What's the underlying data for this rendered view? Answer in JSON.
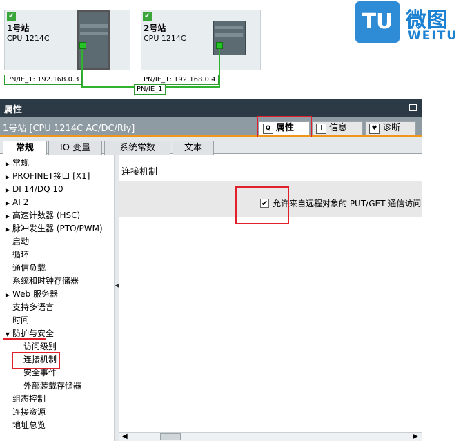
{
  "network": {
    "station1": {
      "name": "1号站",
      "cpu": "CPU 1214C",
      "address": "PN/IE_1: 192.168.0.3"
    },
    "station2": {
      "name": "2号站",
      "cpu": "CPU 1214C",
      "address": "PN/IE_1: 192.168.0.4"
    },
    "subnet": "PN/IE_1",
    "check_glyph": "✔"
  },
  "logo": {
    "cn": "微图",
    "en": "WEITU",
    "mark": "TU"
  },
  "properties": {
    "title": "属性",
    "object_name": "1号站 [CPU 1214C AC/DC/Rly]",
    "right_tabs": [
      {
        "label": "属性",
        "icon": "Q"
      },
      {
        "label": "信息",
        "icon": "i"
      },
      {
        "label": "诊断",
        "icon": "♥"
      }
    ],
    "sub_tabs": [
      "常规",
      "IO 变量",
      "系统常数",
      "文本"
    ],
    "nav": [
      {
        "label": "常规",
        "arrow": "▶"
      },
      {
        "label": "PROFINET接口 [X1]",
        "arrow": "▶"
      },
      {
        "label": "DI 14/DQ 10",
        "arrow": "▶"
      },
      {
        "label": "AI 2",
        "arrow": "▶"
      },
      {
        "label": "高速计数器 (HSC)",
        "arrow": "▶"
      },
      {
        "label": "脉冲发生器 (PTO/PWM)",
        "arrow": "▶"
      },
      {
        "label": "启动",
        "arrow": ""
      },
      {
        "label": "循环",
        "arrow": ""
      },
      {
        "label": "通信负载",
        "arrow": ""
      },
      {
        "label": "系统和时钟存储器",
        "arrow": ""
      },
      {
        "label": "Web 服务器",
        "arrow": "▶"
      },
      {
        "label": "支持多语言",
        "arrow": ""
      },
      {
        "label": "时间",
        "arrow": ""
      },
      {
        "label": "防护与安全",
        "arrow": "▼"
      },
      {
        "label": "访问级别",
        "arrow": ""
      },
      {
        "label": "连接机制",
        "arrow": ""
      },
      {
        "label": "安全事件",
        "arrow": ""
      },
      {
        "label": "外部装载存储器",
        "arrow": ""
      },
      {
        "label": "组态控制",
        "arrow": ""
      },
      {
        "label": "连接资源",
        "arrow": ""
      },
      {
        "label": "地址总览",
        "arrow": ""
      }
    ],
    "section_title": "连接机制",
    "checkbox": {
      "label": "允许来自远程对象的 PUT/GET 通信访问",
      "checked": true,
      "glyph": "✔"
    }
  },
  "scroll": {
    "left": "◀",
    "right": "▶"
  },
  "colors": {
    "accent": "#f0961a",
    "highlight": "#e0202a",
    "network_green": "#2fb32f"
  }
}
